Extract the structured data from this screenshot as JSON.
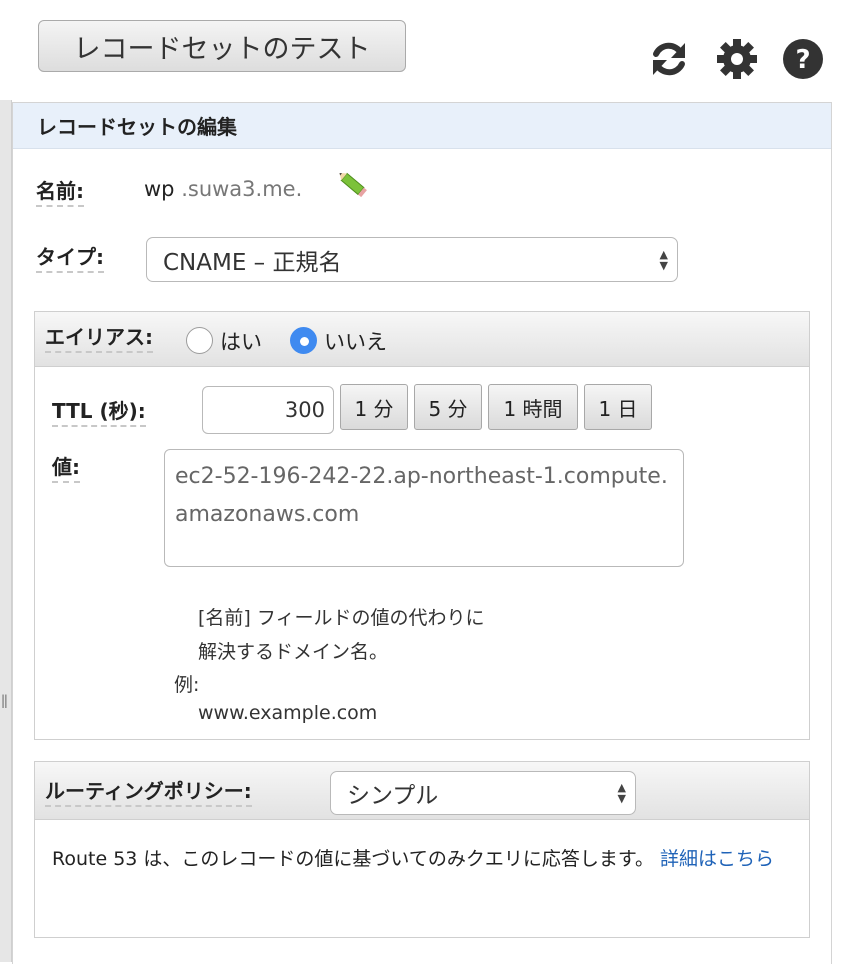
{
  "toolbar": {
    "test_button": "レコードセットのテスト",
    "icons": [
      "refresh-icon",
      "gear-icon",
      "help-icon"
    ]
  },
  "panel": {
    "title": "レコードセットの編集"
  },
  "name_field": {
    "label": "名前:",
    "value": "wp",
    "suffix": ".suwa3.me."
  },
  "type_field": {
    "label": "タイプ:",
    "selected": "CNAME – 正規名"
  },
  "alias": {
    "label": "エイリアス:",
    "yes_label": "はい",
    "no_label": "いいえ",
    "selected": "いいえ"
  },
  "ttl": {
    "label": "TTL (秒):",
    "value": "300",
    "presets": [
      "1 分",
      "5 分",
      "1 時間",
      "1 日"
    ]
  },
  "value_field": {
    "label": "値:",
    "text": "ec2-52-196-242-22.ap-northeast-1.compute.amazonaws.com",
    "help_line1": "[名前] フィールドの値の代わりに",
    "help_line2": "解決するドメイン名。",
    "example_label": "例:",
    "example_value": "www.example.com"
  },
  "routing": {
    "label": "ルーティングポリシー:",
    "selected": "シンプル",
    "description": "Route 53 は、このレコードの値に基づいてのみクエリに応答します。",
    "link_text": "詳細はこちら"
  },
  "colors": {
    "header_bg": "#e8f0fa",
    "radio_selected": "#3f8af0",
    "link": "#1f63b8"
  }
}
